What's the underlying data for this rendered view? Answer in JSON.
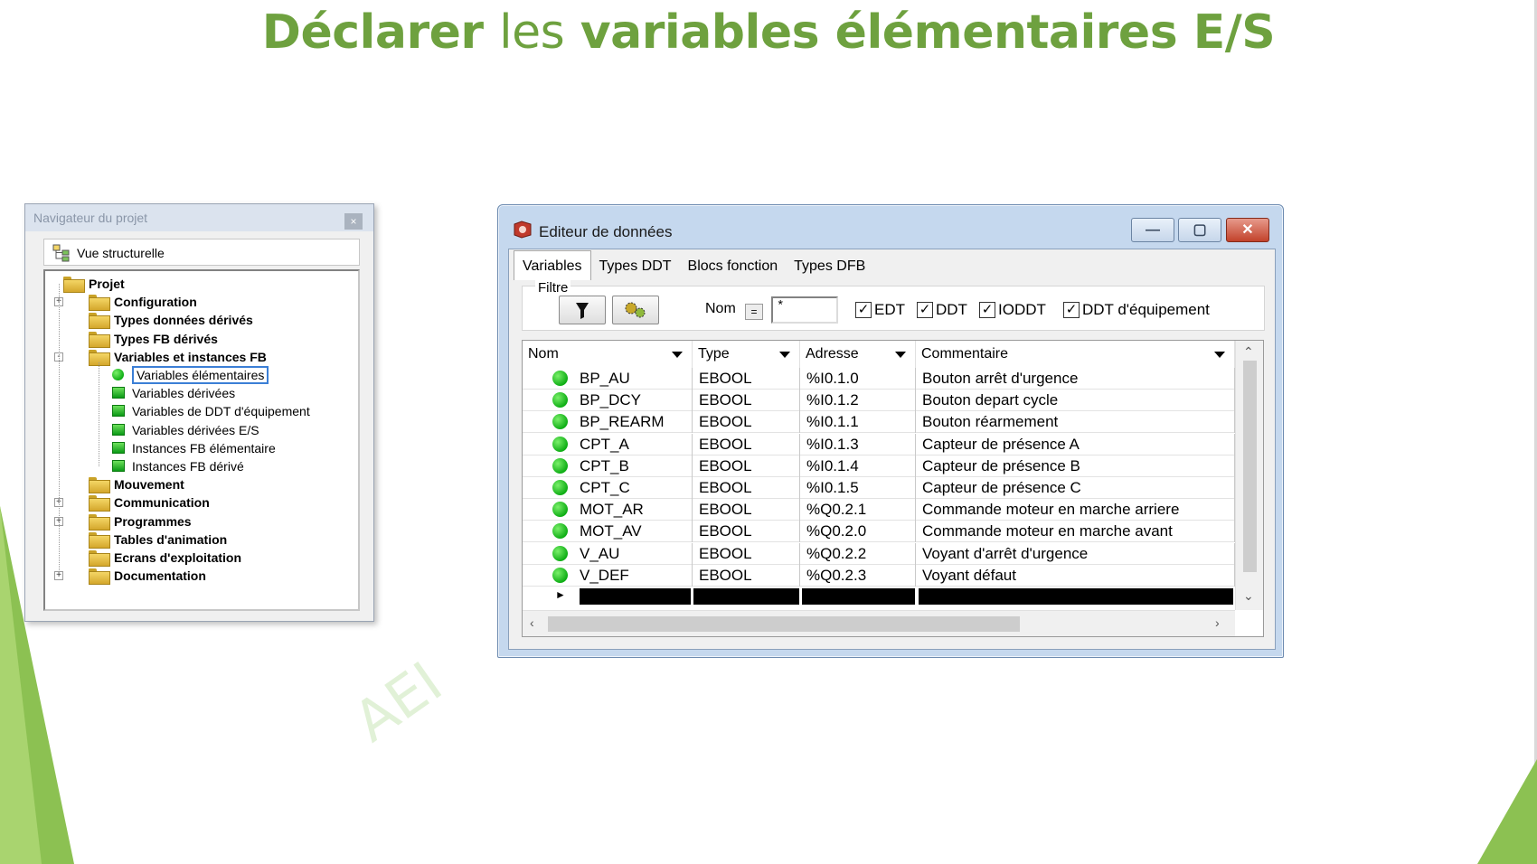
{
  "slide": {
    "title_bold_1": "Déclarer",
    "title_light": "les",
    "title_bold_2": "variables élémentaires E/S",
    "watermark": "AEI",
    "accent_color": "#6ea13f"
  },
  "navigator": {
    "title": "Navigateur du projet",
    "close_glyph": "×",
    "view_label": "Vue structurelle",
    "tree": [
      {
        "label": "Projet",
        "level": 0,
        "bold": true,
        "icon": "folder-open-icon",
        "expander": ""
      },
      {
        "label": "Configuration",
        "level": 1,
        "bold": true,
        "icon": "folder-icon",
        "expander": "+"
      },
      {
        "label": "Types données dérivés",
        "level": 1,
        "bold": true,
        "icon": "folder-icon",
        "expander": ""
      },
      {
        "label": "Types FB dérivés",
        "level": 1,
        "bold": true,
        "icon": "folder-icon",
        "expander": ""
      },
      {
        "label": "Variables et instances FB",
        "level": 1,
        "bold": true,
        "icon": "folder-open-icon",
        "expander": "-"
      },
      {
        "label": "Variables élémentaires",
        "level": 2,
        "bold": false,
        "icon": "variable-dot-icon",
        "selected": true
      },
      {
        "label": "Variables dérivées",
        "level": 2,
        "bold": false,
        "icon": "derived-variable-icon"
      },
      {
        "label": "Variables de DDT d'équipement",
        "level": 2,
        "bold": false,
        "icon": "device-ddt-icon"
      },
      {
        "label": "Variables dérivées E/S",
        "level": 2,
        "bold": false,
        "icon": "io-derived-icon"
      },
      {
        "label": "Instances FB élémentaire",
        "level": 2,
        "bold": false,
        "icon": "fb-instance-icon"
      },
      {
        "label": "Instances FB dérivé",
        "level": 2,
        "bold": false,
        "icon": "fb-derived-instance-icon"
      },
      {
        "label": "Mouvement",
        "level": 1,
        "bold": true,
        "icon": "folder-icon",
        "expander": ""
      },
      {
        "label": "Communication",
        "level": 1,
        "bold": true,
        "icon": "folder-icon",
        "expander": "+"
      },
      {
        "label": "Programmes",
        "level": 1,
        "bold": true,
        "icon": "folder-icon",
        "expander": "+"
      },
      {
        "label": "Tables d'animation",
        "level": 1,
        "bold": true,
        "icon": "folder-icon",
        "expander": ""
      },
      {
        "label": "Ecrans d'exploitation",
        "level": 1,
        "bold": true,
        "icon": "folder-icon",
        "expander": ""
      },
      {
        "label": "Documentation",
        "level": 1,
        "bold": true,
        "icon": "documentation-icon",
        "expander": "+"
      }
    ]
  },
  "editor": {
    "title": "Editeur de données",
    "min_glyph": "—",
    "max_glyph": "▢",
    "close_glyph": "✕",
    "tabs": [
      "Variables",
      "Types DDT",
      "Blocs fonction",
      "Types DFB"
    ],
    "active_tab": 0,
    "filter": {
      "label": "Filtre",
      "nom_label": "Nom",
      "eq_glyph": "=",
      "nom_value": "*",
      "checkboxes": [
        {
          "label": "EDT",
          "checked": true
        },
        {
          "label": "DDT",
          "checked": true
        },
        {
          "label": "IODDT",
          "checked": true
        },
        {
          "label": "DDT d'équipement",
          "checked": true
        }
      ]
    },
    "columns": [
      "Nom",
      "Type",
      "Adresse",
      "Commentaire"
    ],
    "rows": [
      {
        "nom": "BP_AU",
        "type": "EBOOL",
        "adresse": "%I0.1.0",
        "commentaire": "Bouton arrêt d'urgence"
      },
      {
        "nom": "BP_DCY",
        "type": "EBOOL",
        "adresse": "%I0.1.2",
        "commentaire": "Bouton depart cycle"
      },
      {
        "nom": "BP_REARM",
        "type": "EBOOL",
        "adresse": "%I0.1.1",
        "commentaire": "Bouton réarmement"
      },
      {
        "nom": "CPT_A",
        "type": "EBOOL",
        "adresse": "%I0.1.3",
        "commentaire": "Capteur de présence A"
      },
      {
        "nom": "CPT_B",
        "type": "EBOOL",
        "adresse": "%I0.1.4",
        "commentaire": "Capteur de présence B"
      },
      {
        "nom": "CPT_C",
        "type": "EBOOL",
        "adresse": "%I0.1.5",
        "commentaire": "Capteur de présence C"
      },
      {
        "nom": "MOT_AR",
        "type": "EBOOL",
        "adresse": "%Q0.2.1",
        "commentaire": "Commande moteur en marche arriere"
      },
      {
        "nom": "MOT_AV",
        "type": "EBOOL",
        "adresse": "%Q0.2.0",
        "commentaire": "Commande moteur en marche avant"
      },
      {
        "nom": "V_AU",
        "type": "EBOOL",
        "adresse": "%Q0.2.2",
        "commentaire": "Voyant d'arrêt d'urgence"
      },
      {
        "nom": "V_DEF",
        "type": "EBOOL",
        "adresse": "%Q0.2.3",
        "commentaire": "Voyant défaut"
      }
    ]
  }
}
